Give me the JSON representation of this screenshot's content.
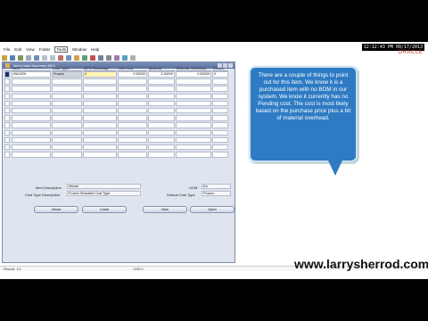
{
  "overlay": {
    "clock": "12:12:43 PM 09/17/2013",
    "brand": "ORACLE",
    "watermark": "www.larrysherrod.com"
  },
  "menu": [
    "File",
    "Edit",
    "View",
    "Folder",
    "Tools",
    "Window",
    "Help"
  ],
  "menu_active_index": 4,
  "window": {
    "title": "Item Costs Summary (M1)"
  },
  "grid": {
    "headers": [
      "Item",
      "Cost Type",
      "MFG Shrinkage",
      "Unit Cost",
      "Material",
      "Material Overhead",
      "Resou"
    ],
    "rows": [
      {
        "item": "AW1000",
        "cost_type": "Frozen",
        "mfg": "0",
        "unit_cost": "3.96000",
        "material": "3.36000",
        "movh": "0.60000",
        "res": "0."
      }
    ],
    "empty_rows": 11
  },
  "fields": {
    "item_description_label": "Item Description",
    "item_description_value": "Mouse",
    "uom_label": "UOM",
    "uom_value": "Ea",
    "cost_type_description_label": "Cost Type Description",
    "cost_type_description_value": "Frozen Standard Cost Type",
    "default_cost_type_label": "Default Cost Type",
    "default_cost_type_value": "Frozen"
  },
  "buttons": {
    "views": "Views",
    "costs": "Costs",
    "new": "New",
    "open": "Open"
  },
  "callout": {
    "text": "There are a couple of things to point out for this item. We know it is a purchased item with no BOM in our system. We know it currently has no Pending cost. The cost is most likely based on the purchase price plus a bit of material overhead."
  },
  "status": {
    "record": "Record: 1/1",
    "osc": "<OSC>"
  },
  "colors": {
    "callout_fill": "#2e7bc4",
    "selected_row_indicator": "#1f2d6e",
    "window_title": "#5a6f9c"
  }
}
